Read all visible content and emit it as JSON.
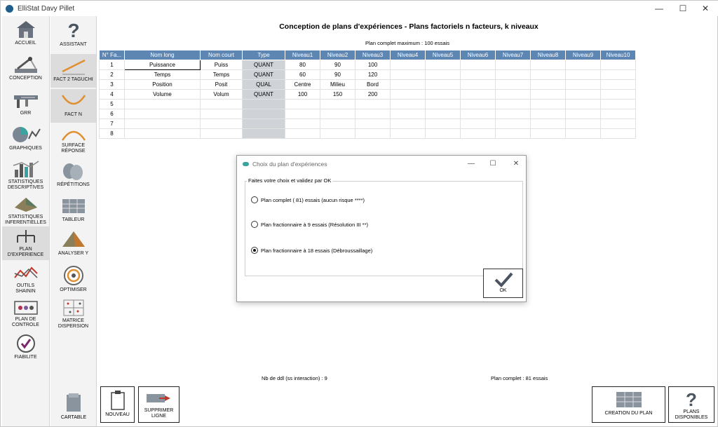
{
  "window": {
    "title": "ElliStat Davy Pillet",
    "controls": {
      "minimize": "—",
      "maximize": "☐",
      "close": "✕"
    }
  },
  "sidebar_left": [
    {
      "id": "accueil",
      "label": "ACCUEIL",
      "icon": "home-icon"
    },
    {
      "id": "conception",
      "label": "CONCEPTION",
      "icon": "drafting-icon"
    },
    {
      "id": "grr",
      "label": "GRR",
      "icon": "caliper-icon"
    },
    {
      "id": "graphiques",
      "label": "GRAPHIQUES",
      "icon": "pie-chart-icon"
    },
    {
      "id": "stat-desc",
      "label": "STATISTIQUES\nDESCRIPTIVES",
      "icon": "bar-chart-icon"
    },
    {
      "id": "stat-inf",
      "label": "STATISTIQUES\nINFERENTIELLES",
      "icon": "surface-icon"
    },
    {
      "id": "plan-exp",
      "label": "PLAN\nD'EXPERIENCE",
      "icon": "tree-icon",
      "active": true
    },
    {
      "id": "shainin",
      "label": "OUTILS\nSHAININ",
      "icon": "shainin-icon"
    },
    {
      "id": "plan-controle",
      "label": "PLAN DE\nCONTROLE",
      "icon": "control-plan-icon"
    },
    {
      "id": "fiabilite",
      "label": "FIABILITE",
      "icon": "check-circle-icon"
    }
  ],
  "sidebar_right": [
    {
      "id": "assistant",
      "label": "ASSISTANT",
      "icon": "question-icon"
    },
    {
      "id": "fact2",
      "label": "FACT 2 TAGUCHI",
      "icon": "line-up-icon",
      "active": true
    },
    {
      "id": "factn",
      "label": "FACT N",
      "icon": "curve-down-icon",
      "active": true
    },
    {
      "id": "surface",
      "label": "SURFACE\nRÉPONSE",
      "icon": "arc-icon"
    },
    {
      "id": "repetitions",
      "label": "RÉPÉTITIONS",
      "icon": "cylinders-icon"
    },
    {
      "id": "tableur",
      "label": "TABLEUR",
      "icon": "spreadsheet-icon"
    },
    {
      "id": "analysery",
      "label": "ANALYSER Y",
      "icon": "pyramid-icon"
    },
    {
      "id": "optimiser",
      "label": "OPTIMISER",
      "icon": "target-icon"
    },
    {
      "id": "matrice",
      "label": "MATRICE\nDISPERSION",
      "icon": "matrix-icon"
    }
  ],
  "cartable": {
    "label": "CARTABLE"
  },
  "main": {
    "title": "Conception de plans d'expériences - Plans factoriels n facteurs, k niveaux",
    "plan_max": "Plan complet maximum : 100 essais",
    "table": {
      "headers": [
        "N° Fa...",
        "Nom long",
        "Nom court",
        "Type",
        "Niveau1",
        "Niveau2",
        "Niveau3",
        "Niveau4",
        "Niveau5",
        "Niveau6",
        "Niveau7",
        "Niveau8",
        "Niveau9",
        "Niveau10"
      ],
      "rows": [
        [
          "1",
          "Puissance",
          "Puiss",
          "QUANT",
          "80",
          "90",
          "100",
          "",
          "",
          "",
          "",
          "",
          "",
          ""
        ],
        [
          "2",
          "Temps",
          "Temps",
          "QUANT",
          "60",
          "90",
          "120",
          "",
          "",
          "",
          "",
          "",
          "",
          ""
        ],
        [
          "3",
          "Position",
          "Posit",
          "QUAL",
          "Centre",
          "Milieu",
          "Bord",
          "",
          "",
          "",
          "",
          "",
          "",
          ""
        ],
        [
          "4",
          "Volume",
          "Volum",
          "QUANT",
          "100",
          "150",
          "200",
          "",
          "",
          "",
          "",
          "",
          "",
          ""
        ],
        [
          "5",
          "",
          "",
          "",
          "",
          "",
          "",
          "",
          "",
          "",
          "",
          "",
          "",
          ""
        ],
        [
          "6",
          "",
          "",
          "",
          "",
          "",
          "",
          "",
          "",
          "",
          "",
          "",
          "",
          ""
        ],
        [
          "7",
          "",
          "",
          "",
          "",
          "",
          "",
          "",
          "",
          "",
          "",
          "",
          "",
          ""
        ],
        [
          "8",
          "",
          "",
          "",
          "",
          "",
          "",
          "",
          "",
          "",
          "",
          "",
          "",
          ""
        ]
      ]
    },
    "nb_ddl": "Nb de ddl (ss interaction) :  9",
    "plan_complet": "Plan complet :  81 essais"
  },
  "buttons": {
    "nouveau": "NOUVEAU",
    "supprimer": "SUPPRIMER\nLIGNE",
    "creation": "CREATION DU PLAN",
    "plans_dispo": "PLANS\nDISPONIBLES"
  },
  "dialog": {
    "title": "Choix du plan d'expériences",
    "group_label": "Faites votre choix et validez par OK",
    "options": [
      {
        "label": "Plan complet ( 81) essais (aucun risque ****)",
        "selected": false
      },
      {
        "label": "Plan fractionnaire à 9 essais (Résolution III **)",
        "selected": false
      },
      {
        "label": "Plan fractionnaire à 18 essais (Débroussaillage)",
        "selected": true
      }
    ],
    "ok_label": "OK",
    "controls": {
      "minimize": "—",
      "maximize": "☐",
      "close": "✕"
    }
  }
}
